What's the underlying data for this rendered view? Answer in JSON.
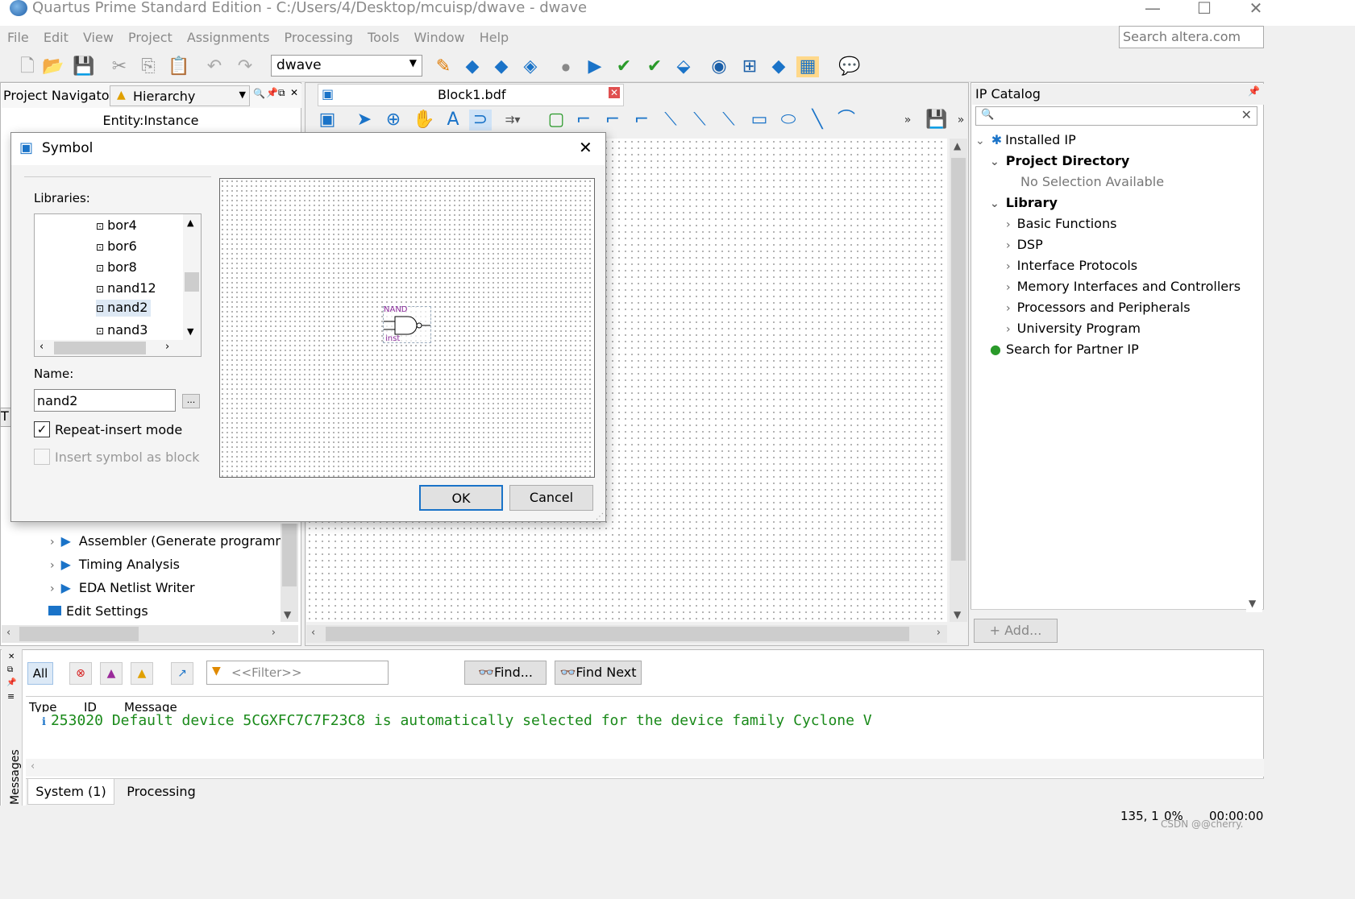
{
  "window": {
    "title": "Quartus Prime Standard Edition - C:/Users/4/Desktop/mcuisp/dwave - dwave",
    "minimize": "—",
    "maximize": "☐",
    "close": "✕"
  },
  "menu": [
    "File",
    "Edit",
    "View",
    "Project",
    "Assignments",
    "Processing",
    "Tools",
    "Window",
    "Help"
  ],
  "web_search": {
    "placeholder": "Search altera.com"
  },
  "toolbar": {
    "project_value": "dwave"
  },
  "navigator": {
    "label": "Project Navigator",
    "view_value": "Hierarchy",
    "column_header": "Entity:Instance",
    "tasks_tab_letter": "T",
    "tasks": [
      {
        "label": "Assembler (Generate programm"
      },
      {
        "label": "Timing Analysis"
      },
      {
        "label": "EDA Netlist Writer"
      },
      {
        "label": "Edit Settings"
      }
    ]
  },
  "editor": {
    "tab_title": "Block1.bdf"
  },
  "ip_catalog": {
    "title": "IP Catalog",
    "installed_ip": "Installed IP",
    "project_directory": "Project Directory",
    "no_selection": "No Selection Available",
    "library": "Library",
    "library_items": [
      "Basic Functions",
      "DSP",
      "Interface Protocols",
      "Memory Interfaces and Controllers",
      "Processors and Peripherals",
      "University Program"
    ],
    "partner": "Search for Partner IP",
    "add_button": "+ Add..."
  },
  "symbol_dialog": {
    "title": "Symbol",
    "libraries_label": "Libraries:",
    "library_items": [
      "bor4",
      "bor6",
      "bor8",
      "nand12",
      "nand2",
      "nand3"
    ],
    "selected_item": "nand2",
    "name_label": "Name:",
    "name_value": "nand2",
    "browse_button": "...",
    "repeat_insert_label": "Repeat-insert mode",
    "repeat_insert_checked": true,
    "insert_block_label": "Insert symbol as block",
    "insert_block_checked": false,
    "preview_symbol_top": "NAND",
    "preview_symbol_bottom": "inst",
    "ok_button": "OK",
    "cancel_button": "Cancel"
  },
  "messages": {
    "vertical_label": "Messages",
    "all_button": "All",
    "filter_placeholder": "<<Filter>>",
    "find_button": "Find...",
    "find_next_button": "Find Next",
    "columns": [
      "Type",
      "ID",
      "Message"
    ],
    "rows": [
      {
        "id": "253020",
        "message": "Default device 5CGXFC7C7F23C8 is automatically selected for the device family Cyclone V"
      }
    ],
    "tabs": [
      "System (1)",
      "Processing"
    ]
  },
  "status": {
    "position": "135, 1",
    "percent": "0%",
    "time": "00:00:00",
    "watermark": "CSDN @@cherry."
  },
  "colors": {
    "message_green": "#1a8a1a",
    "accent_blue": "#1a73c8",
    "symbol_purple": "#8a2a9a"
  }
}
